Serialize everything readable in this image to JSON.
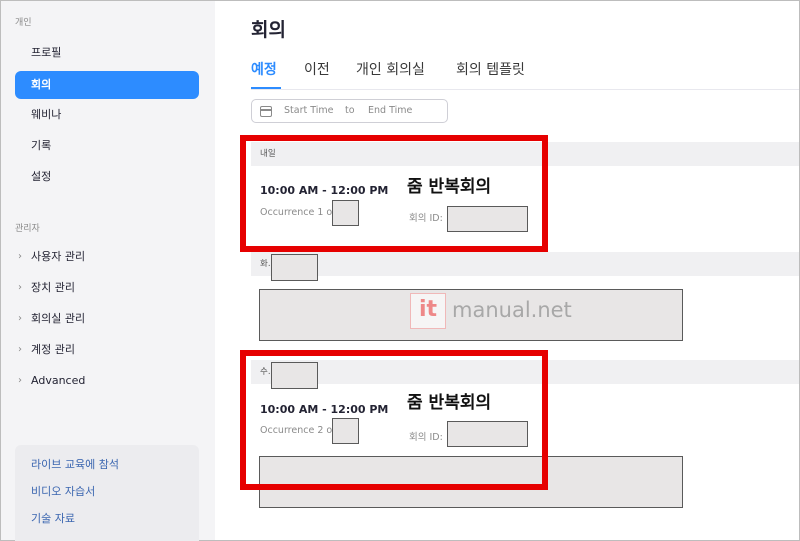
{
  "sidebar": {
    "personal_section": "개인",
    "personal_items": [
      "프로필",
      "회의",
      "웨비나",
      "기록",
      "설정"
    ],
    "active_item": "회의",
    "admin_section": "관리자",
    "admin_items": [
      "사용자 관리",
      "장치 관리",
      "회의실 관리",
      "계정 관리",
      "Advanced"
    ],
    "bottom_links": [
      "라이브 교육에 참석",
      "비디오 자습서",
      "기술 자료"
    ]
  },
  "main": {
    "title": "회의",
    "tabs": [
      "예정",
      "이전",
      "개인 회의실",
      "회의 템플릿"
    ],
    "active_tab": "예정",
    "date_range": {
      "start": "Start Time",
      "to": "to",
      "end": "End Time"
    },
    "days": [
      {
        "header": "내일",
        "meeting": {
          "time": "10:00 AM - 12:00 PM",
          "occurrence": "Occurrence 1 of",
          "id_label": "회의 ID:",
          "annotation": "줌 반복회의"
        }
      },
      {
        "header": "화."
      },
      {
        "header": "수.",
        "meeting": {
          "time": "10:00 AM - 12:00 PM",
          "occurrence": "Occurrence 2 of",
          "id_label": "회의 ID:",
          "annotation": "줌 반복회의"
        }
      }
    ]
  },
  "watermark": {
    "logo": "it",
    "text": "manual.net"
  },
  "colors": {
    "accent": "#2d8cff",
    "highlight": "#e60000",
    "sidebar_bg": "#f4f4f6"
  }
}
